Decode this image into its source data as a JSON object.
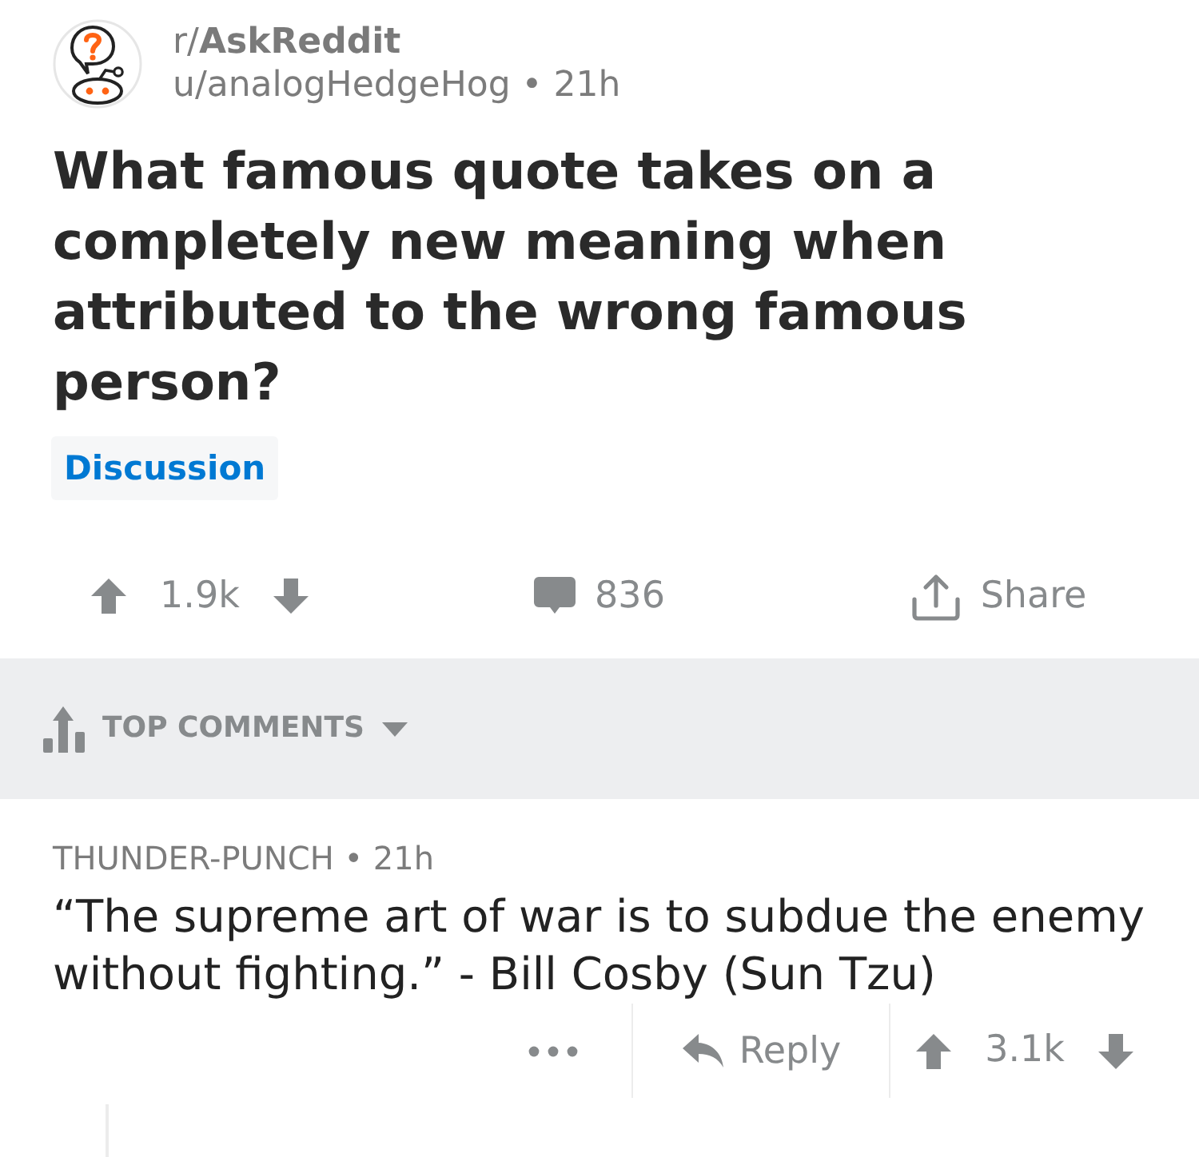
{
  "post": {
    "subreddit": "r/**AskReddit**",
    "byline": "u/analogHedgeHog • 21h",
    "title": "What famous quote takes on a completely new meaning when attributed to the wrong famous person?",
    "flair": "Discussion"
  },
  "actions": {
    "score": "1.9k",
    "comments": "836",
    "share": "Share"
  },
  "sort": {
    "label": "TOP COMMENTS"
  },
  "comments": [
    {
      "byline": "THUNDER-PUNCH • 21h",
      "body": "“The supreme art of war is to subdue the enemy without fighting.” - Bill Cosby (Sun Tzu)",
      "reply": "Reply",
      "score": "3.1k"
    }
  ]
}
